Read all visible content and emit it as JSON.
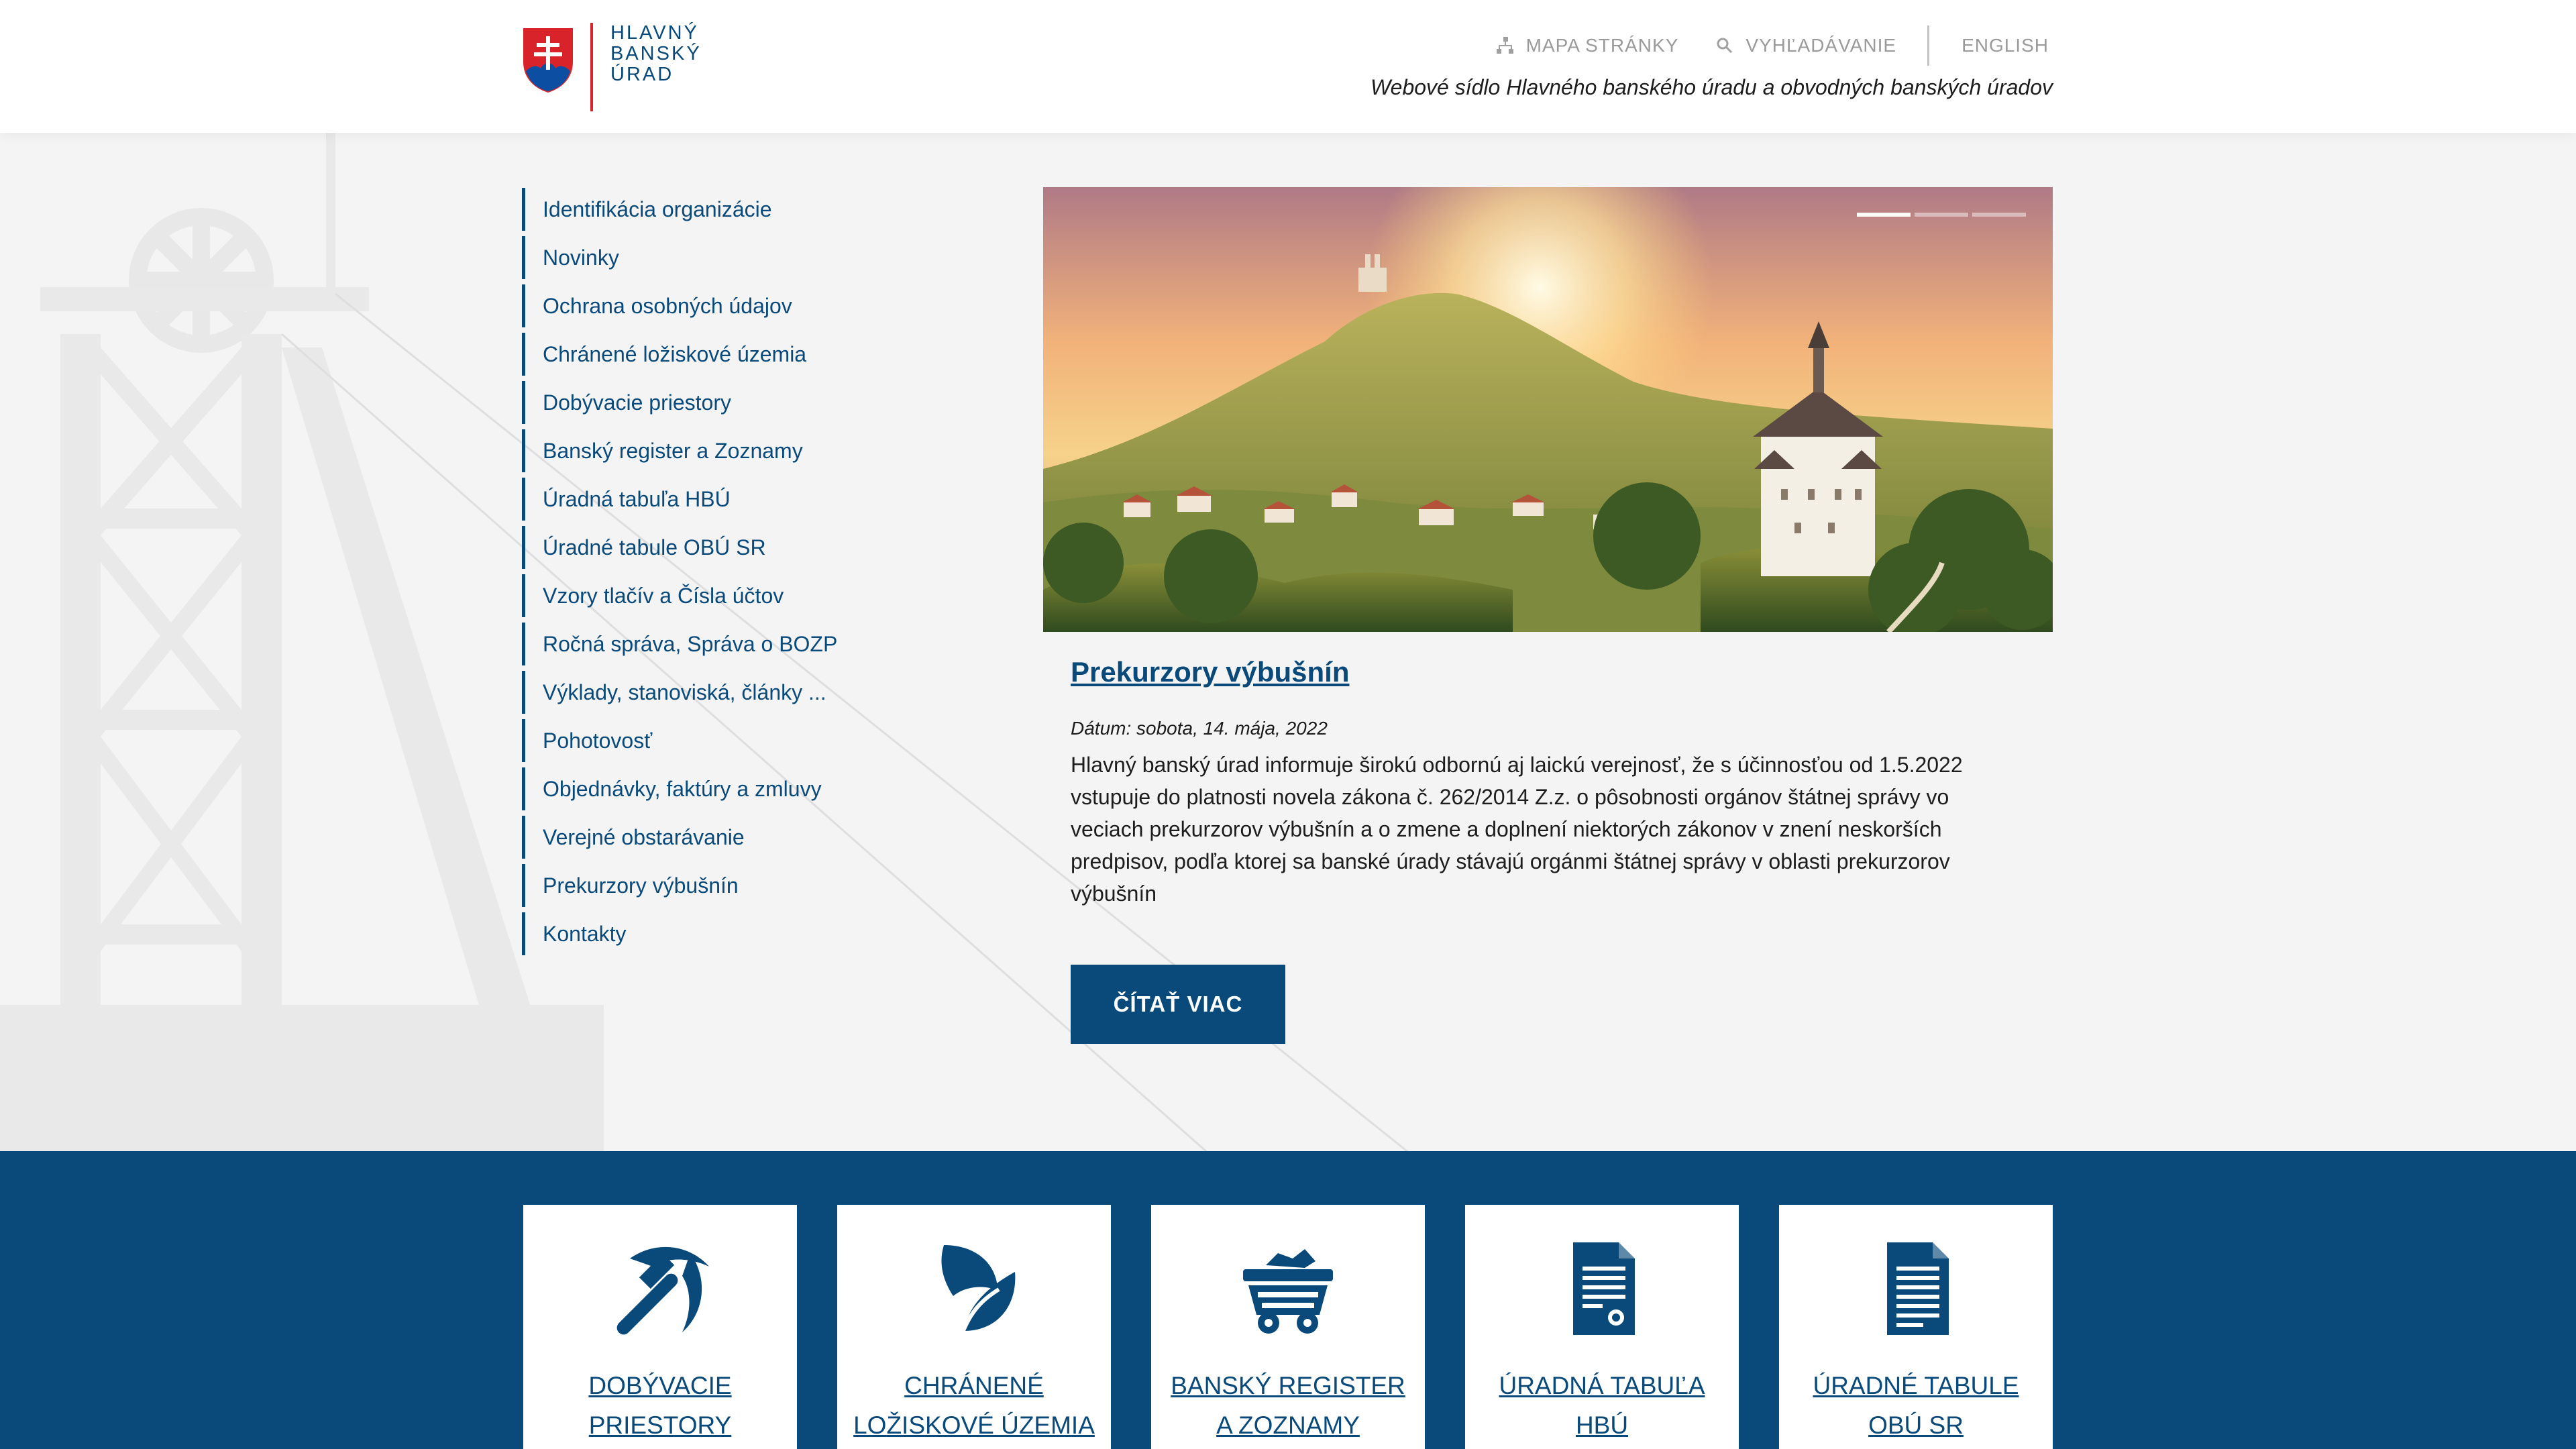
{
  "header": {
    "logo_lines": [
      "HLAVNÝ",
      "BANSKÝ",
      "ÚRAD"
    ],
    "sitemap_label": "MAPA STRÁNKY",
    "search_label": "VYHĽADÁVANIE",
    "language_label": "ENGLISH",
    "tagline": "Webové sídlo Hlavného banského úradu a obvodných banských úradov"
  },
  "sidebar": {
    "items": [
      {
        "label": "Identifikácia organizácie"
      },
      {
        "label": "Novinky"
      },
      {
        "label": "Ochrana osobných údajov"
      },
      {
        "label": "Chránené ložiskové územia"
      },
      {
        "label": "Dobývacie priestory"
      },
      {
        "label": "Banský register a Zoznamy"
      },
      {
        "label": "Úradná tabuľa HBÚ"
      },
      {
        "label": "Úradné tabule OBÚ SR"
      },
      {
        "label": "Vzory tlačív a Čísla účtov"
      },
      {
        "label": "Ročná správa, Správa o BOZP"
      },
      {
        "label": "Výklady, stanoviská, články ..."
      },
      {
        "label": "Pohotovosť"
      },
      {
        "label": "Objednávky, faktúry a zmluvy"
      },
      {
        "label": "Verejné obstarávanie"
      },
      {
        "label": "Prekurzory výbušnín"
      },
      {
        "label": "Kontakty"
      }
    ]
  },
  "hero": {
    "slides_total": 3,
    "active_slide": 1
  },
  "article": {
    "title": "Prekurzory výbušnín",
    "date": "Dátum: sobota, 14. mája, 2022",
    "text": "Hlavný banský úrad informuje širokú odbornú aj laickú verejnosť, že s účinnosťou od 1.5.2022 vstupuje do platnosti novela zákona č. 262/2014 Z.z. o pôsobnosti orgánov štátnej správy vo veciach prekurzorov výbušnín a o zmene a doplnení niektorých zákonov v znení neskorších predpisov, podľa ktorej sa banské úrady stávajú orgánmi štátnej správy v oblasti prekurzorov výbušnín",
    "read_more_label": "ČÍTAŤ VIAC"
  },
  "cards": [
    {
      "icon": "pickaxe-icon",
      "line1": "DOBÝVACIE",
      "line2": "PRIESTORY"
    },
    {
      "icon": "leaf-icon",
      "line1": "CHRÁNENÉ",
      "line2": "LOŽISKOVÉ ÚZEMIA"
    },
    {
      "icon": "mine-cart-icon",
      "line1": "BANSKÝ REGISTER",
      "line2": "A ZOZNAMY"
    },
    {
      "icon": "certificate-document-icon",
      "line1": "ÚRADNÁ TABUĽA",
      "line2": "HBÚ"
    },
    {
      "icon": "document-icon",
      "line1": "ÚRADNÉ TABULE",
      "line2": "OBÚ SR"
    }
  ],
  "colors": {
    "brand_blue": "#0a4a7a",
    "accent_red": "#d8232a",
    "page_bg": "#f4f4f4",
    "muted_gray": "#9a9a9a"
  }
}
